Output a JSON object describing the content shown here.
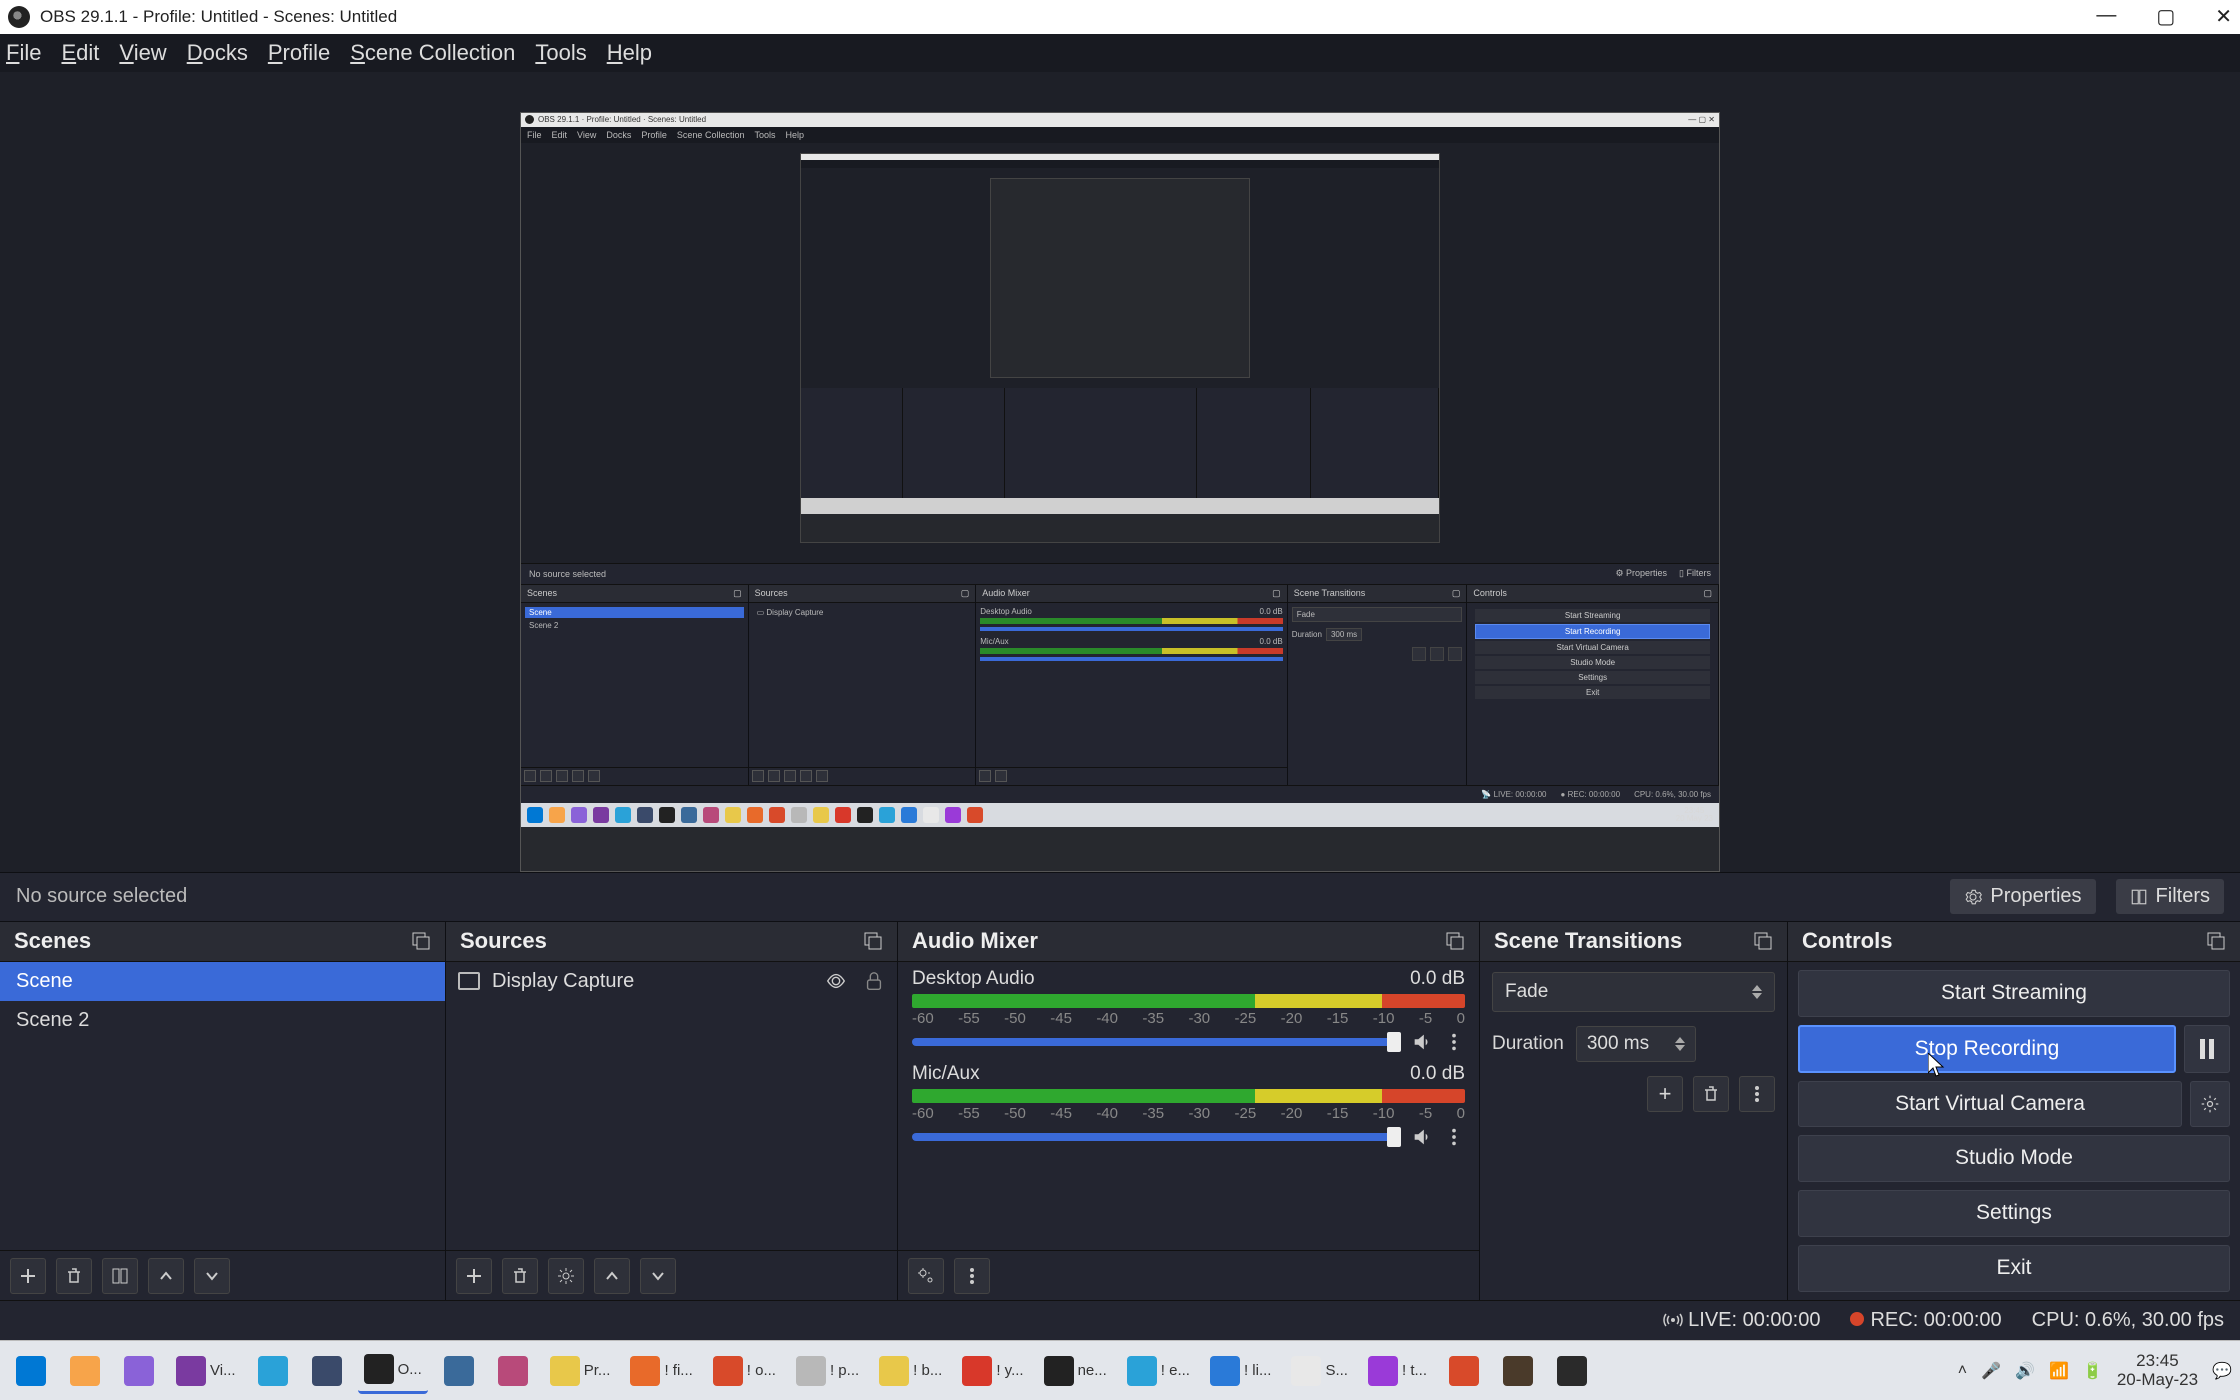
{
  "window": {
    "title": "OBS 29.1.1 - Profile: Untitled - Scenes: Untitled"
  },
  "menu": {
    "file": "File",
    "edit": "Edit",
    "view": "View",
    "docks": "Docks",
    "profile": "Profile",
    "scene_collection": "Scene Collection",
    "tools": "Tools",
    "help": "Help"
  },
  "source_toolbar": {
    "status": "No source selected",
    "properties": "Properties",
    "filters": "Filters"
  },
  "scenes": {
    "title": "Scenes",
    "items": [
      "Scene",
      "Scene 2"
    ],
    "selected": 0
  },
  "sources": {
    "title": "Sources",
    "items": [
      {
        "name": "Display Capture",
        "visible": true,
        "locked": false
      }
    ]
  },
  "mixer": {
    "title": "Audio Mixer",
    "channels": [
      {
        "name": "Desktop Audio",
        "db": "0.0 dB",
        "ticks": [
          "-60",
          "-55",
          "-50",
          "-45",
          "-40",
          "-35",
          "-30",
          "-25",
          "-20",
          "-15",
          "-10",
          "-5",
          "0"
        ]
      },
      {
        "name": "Mic/Aux",
        "db": "0.0 dB",
        "ticks": [
          "-60",
          "-55",
          "-50",
          "-45",
          "-40",
          "-35",
          "-30",
          "-25",
          "-20",
          "-15",
          "-10",
          "-5",
          "0"
        ]
      }
    ]
  },
  "transitions": {
    "title": "Scene Transitions",
    "selected": "Fade",
    "duration_label": "Duration",
    "duration_value": "300 ms"
  },
  "controls": {
    "title": "Controls",
    "start_streaming": "Start Streaming",
    "stop_recording": "Stop Recording",
    "start_virtual_camera": "Start Virtual Camera",
    "studio_mode": "Studio Mode",
    "settings": "Settings",
    "exit": "Exit"
  },
  "statusbar": {
    "live": "LIVE: 00:00:00",
    "rec": "REC: 00:00:00",
    "cpu": "CPU: 0.6%, 30.00 fps"
  },
  "inner": {
    "title": "OBS 29.1.1 · Profile: Untitled · Scenes: Untitled",
    "menu": [
      "File",
      "Edit",
      "View",
      "Docks",
      "Profile",
      "Scene Collection",
      "Tools",
      "Help"
    ],
    "srcrow_status": "No source selected",
    "srcrow_props": "Properties",
    "srcrow_filters": "Filters",
    "panels": {
      "scenes_title": "Scenes",
      "scenes": [
        "Scene",
        "Scene 2"
      ],
      "sources_title": "Sources",
      "sources": [
        "Display Capture"
      ],
      "mixer_title": "Audio Mixer",
      "mixer": [
        {
          "name": "Desktop Audio",
          "db": "0.0 dB"
        },
        {
          "name": "Mic/Aux",
          "db": "0.0 dB"
        }
      ],
      "trans_title": "Scene Transitions",
      "trans_sel": "Fade",
      "trans_dur_lbl": "Duration",
      "trans_dur": "300 ms",
      "ctl_title": "Controls",
      "ctl": [
        "Start Streaming",
        "Start Recording",
        "Start Virtual Camera",
        "Studio Mode",
        "Settings",
        "Exit"
      ]
    },
    "status": {
      "live": "LIVE: 00:00:00",
      "rec": "REC: 00:00:00",
      "cpu": "CPU: 0.6%, 30.00 fps"
    }
  },
  "taskbar": {
    "items": [
      {
        "color": "#0078d4",
        "label": ""
      },
      {
        "color": "#f7a44a",
        "label": ""
      },
      {
        "color": "#8a62d8",
        "label": ""
      },
      {
        "color": "#7a3aa0",
        "label": "Vi..."
      },
      {
        "color": "#2aa2d8",
        "label": ""
      },
      {
        "color": "#3a4a6a",
        "label": ""
      },
      {
        "color": "#222",
        "label": "O..."
      },
      {
        "color": "#3a6a9a",
        "label": ""
      },
      {
        "color": "#b84a7a",
        "label": ""
      },
      {
        "color": "#e8c84a",
        "label": "Pr..."
      },
      {
        "color": "#e86a2a",
        "label": "! fi..."
      },
      {
        "color": "#d84a2a",
        "label": "! o..."
      },
      {
        "color": "#b8b8b8",
        "label": "! p..."
      },
      {
        "color": "#e8c84a",
        "label": "! b..."
      },
      {
        "color": "#d8382a",
        "label": "! y..."
      },
      {
        "color": "#222",
        "label": "ne..."
      },
      {
        "color": "#2aa2d8",
        "label": "! e..."
      },
      {
        "color": "#2a7ad8",
        "label": "! li..."
      },
      {
        "color": "#e8e8e8",
        "label": "S..."
      },
      {
        "color": "#9a3ad8",
        "label": "! t..."
      },
      {
        "color": "#d84a2a",
        "label": ""
      },
      {
        "color": "#4a3a2a",
        "label": ""
      },
      {
        "color": "#2a2a2a",
        "label": ""
      }
    ],
    "time": "23:45",
    "date": "20-May-23"
  }
}
